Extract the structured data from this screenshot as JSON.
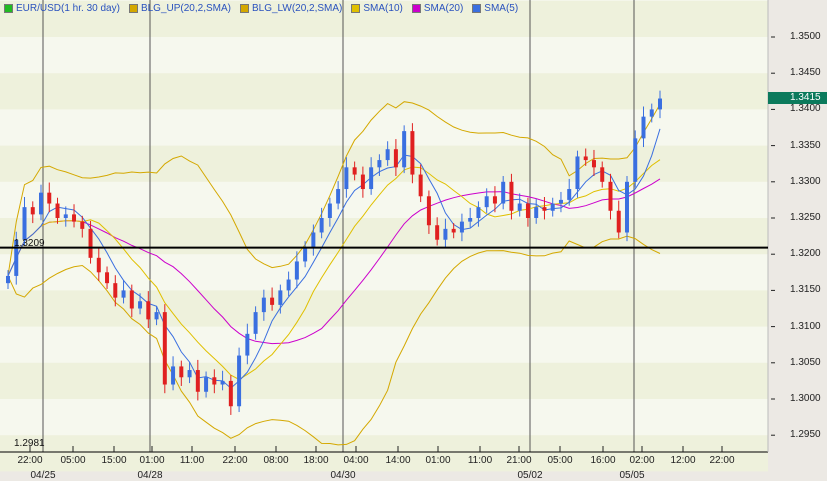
{
  "chart_data": {
    "type": "candlestick",
    "legend": [
      {
        "label": "EUR/USD(1 hr. 30 day)",
        "color": "#22bb22"
      },
      {
        "label": "BLG_UP(20,2,SMA)",
        "color": "#d4a800"
      },
      {
        "label": "BLG_LW(20,2,SMA)",
        "color": "#d4a800"
      },
      {
        "label": "SMA(10)",
        "color": "#e0c000"
      },
      {
        "label": "SMA(20)",
        "color": "#cc00cc"
      },
      {
        "label": "SMA(5)",
        "color": "#3a6fe0"
      }
    ],
    "legend_placement": "top-left",
    "ylim": [
      1.2935,
      1.3555
    ],
    "yticks": [
      "1.3500",
      "1.3450",
      "1.3400",
      "1.3350",
      "1.3300",
      "1.3250",
      "1.3200",
      "1.3150",
      "1.3100",
      "1.3050",
      "1.3000",
      "1.2950"
    ],
    "xticks": [
      "22:00",
      "05:00",
      "15:00",
      "01:00",
      "11:00",
      "22:00",
      "08:00",
      "18:00",
      "04:00",
      "14:00",
      "01:00",
      "11:00",
      "21:00",
      "05:00",
      "16:00",
      "02:00",
      "12:00",
      "22:00"
    ],
    "date_labels": [
      "04/25",
      "04/28",
      "04/30",
      "05/02",
      "05/05"
    ],
    "current_price": "1.3415",
    "horizontal_line": {
      "value": 1.3209,
      "label": "1.3209"
    },
    "low_label": "1.2981",
    "colors": {
      "up": "#3a6fe0",
      "down": "#e02020",
      "band": "#d4a800",
      "sma10": "#e0c000",
      "sma20": "#cc00cc",
      "sma5": "#3a6fe0"
    },
    "closes": [
      1.317,
      1.322,
      1.3265,
      1.3255,
      1.3285,
      1.327,
      1.325,
      1.3255,
      1.3245,
      1.3235,
      1.3195,
      1.3175,
      1.316,
      1.314,
      1.315,
      1.3125,
      1.3135,
      1.311,
      1.312,
      1.302,
      1.3045,
      1.303,
      1.304,
      1.301,
      1.303,
      1.302,
      1.3025,
      1.299,
      1.306,
      1.309,
      1.312,
      1.314,
      1.313,
      1.315,
      1.3165,
      1.319,
      1.321,
      1.323,
      1.325,
      1.327,
      1.329,
      1.332,
      1.331,
      1.329,
      1.332,
      1.333,
      1.3345,
      1.332,
      1.337,
      1.331,
      1.328,
      1.324,
      1.322,
      1.3235,
      1.323,
      1.3245,
      1.325,
      1.3265,
      1.328,
      1.327,
      1.33,
      1.326,
      1.327,
      1.325,
      1.3265,
      1.326,
      1.327,
      1.3275,
      1.329,
      1.3335,
      1.333,
      1.332,
      1.33,
      1.326,
      1.323,
      1.33,
      1.336,
      1.339,
      1.34,
      1.3415
    ]
  }
}
